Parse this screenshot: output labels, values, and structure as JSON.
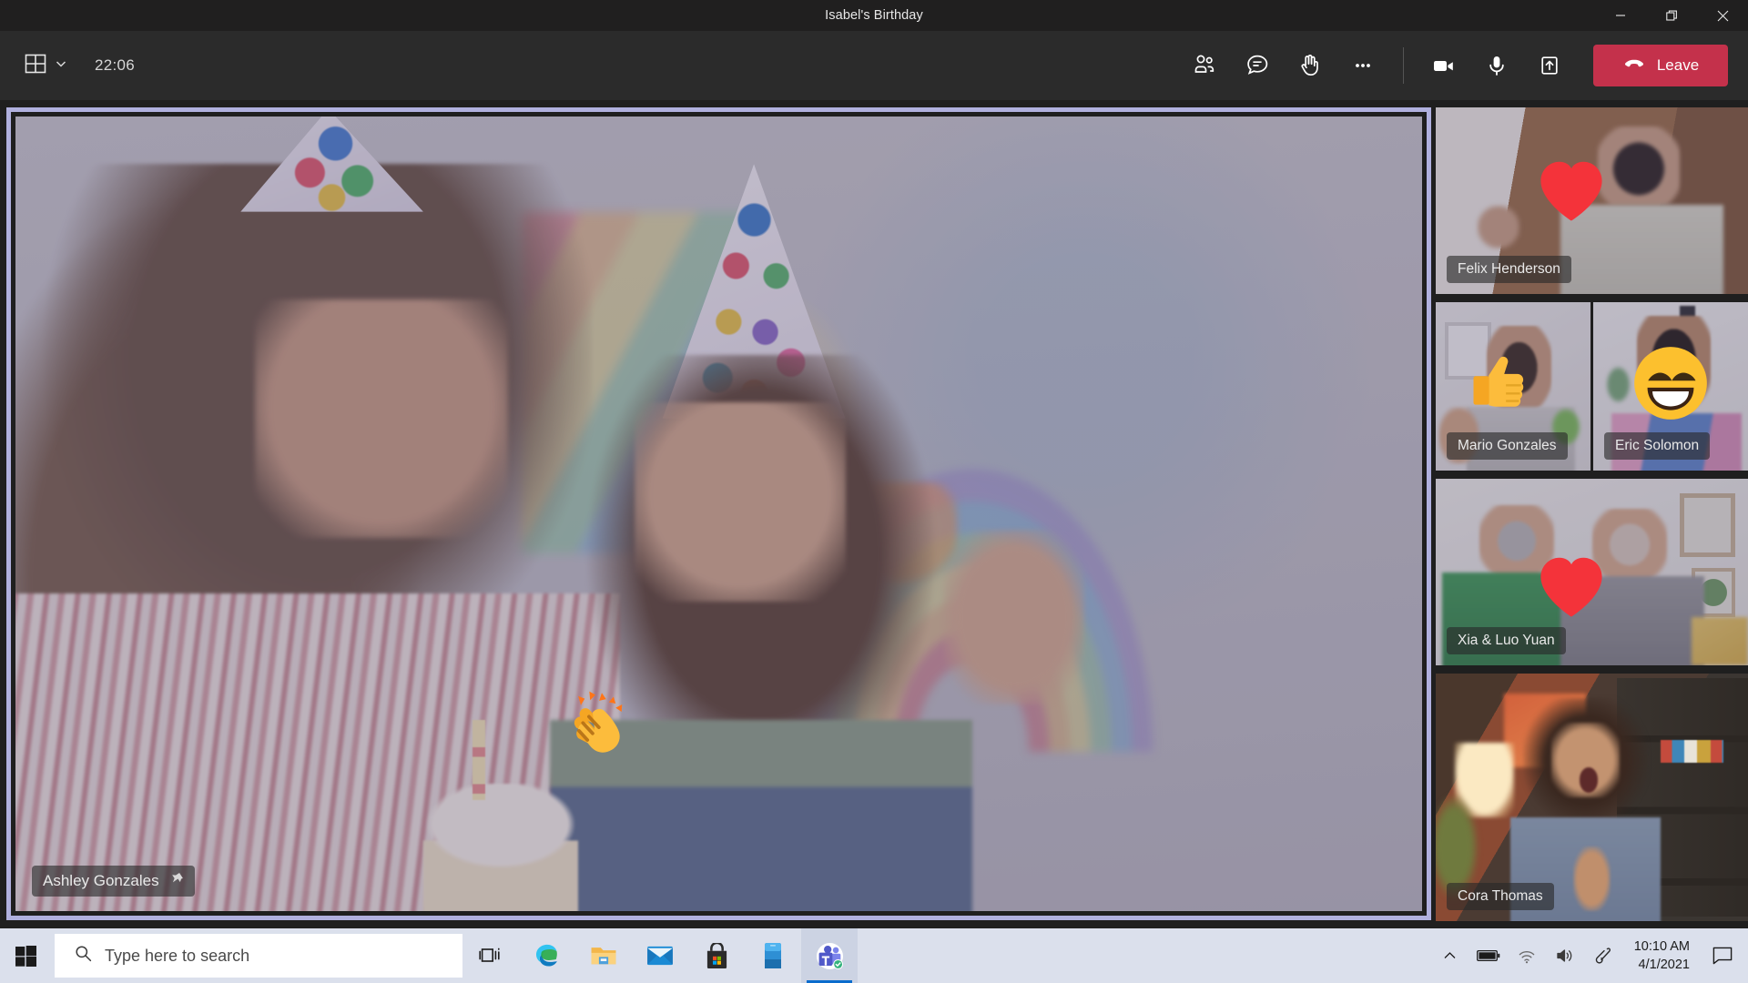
{
  "window": {
    "title": "Isabel's Birthday",
    "controls": {
      "minimize": "minimize-icon",
      "restore": "restore-icon",
      "close": "close-icon"
    }
  },
  "toolbar": {
    "layout_icon": "grid-layout-icon",
    "layout_chevron": "chevron-down-icon",
    "timer": "22:06",
    "actions": [
      {
        "name": "people-icon",
        "label": "Show participants"
      },
      {
        "name": "chat-icon",
        "label": "Show conversation"
      },
      {
        "name": "raise-hand-icon",
        "label": "Raise hand"
      },
      {
        "name": "more-options-icon",
        "label": "More actions"
      }
    ],
    "devices": [
      {
        "name": "camera-icon",
        "label": "Camera"
      },
      {
        "name": "microphone-icon",
        "label": "Mute"
      },
      {
        "name": "share-screen-icon",
        "label": "Share content"
      }
    ],
    "leave_label": "Leave",
    "leave_color": "#c4314b"
  },
  "stage": {
    "spotlight": {
      "name": "Ashley Gonzales",
      "pinned": true,
      "pin_icon": "pin-icon",
      "border_color": "#b0b0de",
      "reaction": "clap"
    },
    "participants": [
      {
        "name": "Felix Henderson",
        "reaction": "heart"
      },
      {
        "name": "Mario Gonzales",
        "reaction": "thumbs-up"
      },
      {
        "name": "Eric Solomon",
        "reaction": "laugh"
      },
      {
        "name": "Xia & Luo Yuan",
        "reaction": "heart"
      },
      {
        "name": "Cora Thomas",
        "reaction": "none"
      }
    ]
  },
  "taskbar": {
    "start_icon": "windows-start-icon",
    "search": {
      "placeholder": "Type here to search",
      "icon": "search-icon"
    },
    "apps": [
      {
        "name": "task-view-icon",
        "label": "Task View"
      },
      {
        "name": "edge-icon",
        "label": "Microsoft Edge"
      },
      {
        "name": "file-explorer-icon",
        "label": "File Explorer"
      },
      {
        "name": "mail-icon",
        "label": "Mail"
      },
      {
        "name": "microsoft-store-icon",
        "label": "Microsoft Store"
      },
      {
        "name": "your-phone-icon",
        "label": "Your Phone"
      },
      {
        "name": "teams-icon",
        "label": "Microsoft Teams",
        "active": true,
        "badge": "available-status"
      }
    ],
    "tray": [
      {
        "name": "show-hidden-icons-icon"
      },
      {
        "name": "battery-icon"
      },
      {
        "name": "wifi-icon"
      },
      {
        "name": "volume-icon"
      },
      {
        "name": "pen-menu-icon"
      }
    ],
    "clock": {
      "time": "10:10 AM",
      "date": "4/1/2021"
    },
    "action_center_icon": "action-center-icon"
  }
}
